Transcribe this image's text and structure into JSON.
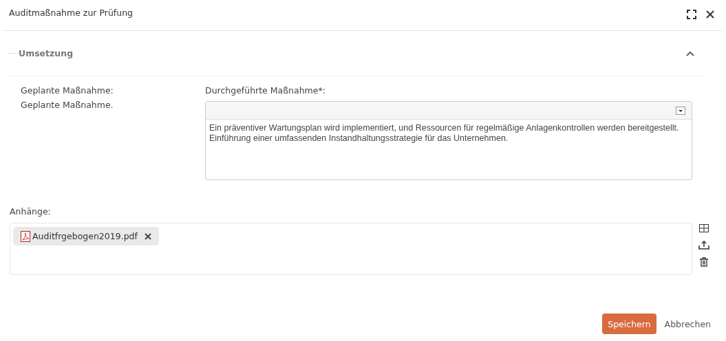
{
  "window": {
    "title": "Auditmaßnahme zur Prüfung"
  },
  "section": {
    "title": "Umsetzung",
    "expanded": true
  },
  "planned": {
    "label": "Geplante Maßnahme:",
    "value": "Geplante Maßnahme."
  },
  "performed": {
    "label": "Durchgeführte Maßnahme*:",
    "value": "Ein präventiver Wartungsplan wird implementiert, und Ressourcen für regelmäßige Anlagenkontrollen werden bereitgestellt. Einführung einer umfassenden Instandhaltungsstrategie für das Unternehmen."
  },
  "attachments": {
    "label": "Anhänge:",
    "files": [
      {
        "name": "Auditfrgebogen2019.pdf"
      }
    ]
  },
  "buttons": [
    {
      "label": "Speichern",
      "kind": "primary"
    },
    {
      "label": "Abbrechen",
      "kind": "secondary"
    }
  ]
}
